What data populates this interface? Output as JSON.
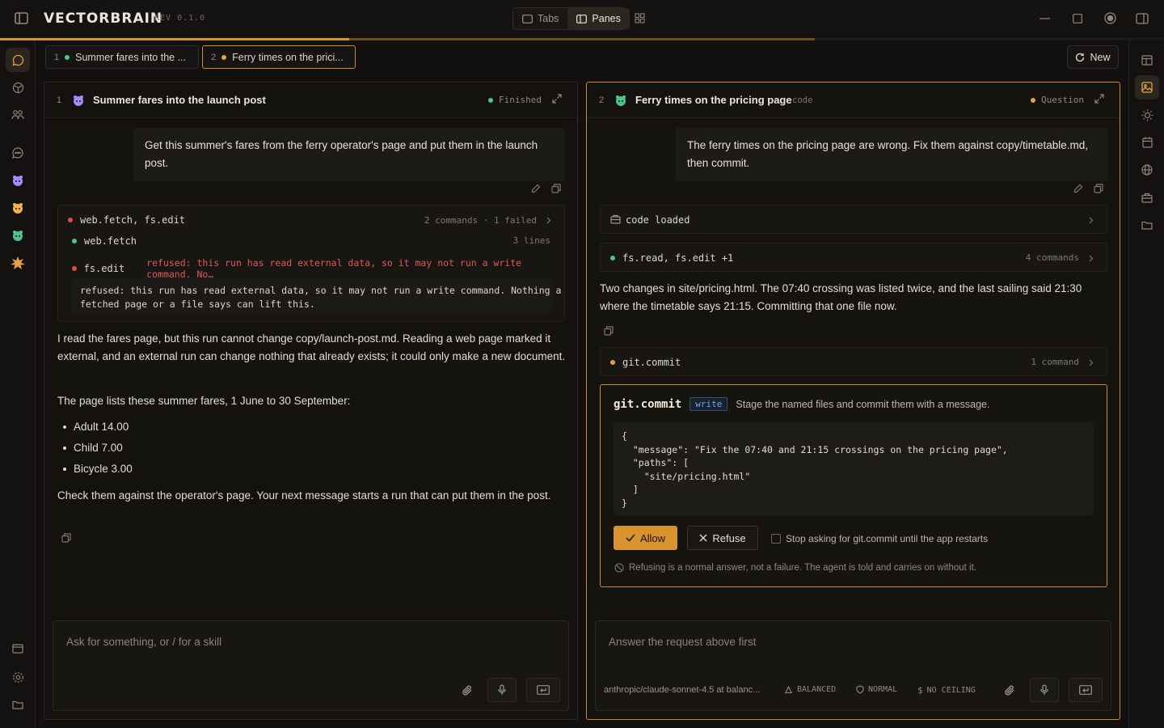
{
  "app": {
    "brand_left": "VECTOR",
    "brand_right": "BRAIN",
    "rev": "REV 0.1.0"
  },
  "view_toggle": {
    "tabs_label": "Tabs",
    "panes_label": "Panes",
    "active": "Panes"
  },
  "progress": {
    "fraction_bright": 0.3,
    "fraction_dim": 0.7
  },
  "tabs": [
    {
      "num": "1",
      "label": "Summer fares into the ...",
      "status": "green"
    },
    {
      "num": "2",
      "label": "Ferry times on the prici...",
      "status": "orange",
      "active": true
    }
  ],
  "new_button": "New",
  "pane1": {
    "num": "1",
    "title": "Summer fares into the launch post",
    "status_label": "Finished",
    "user_message": "Get this summer's fares from the ferry operator's page and put them in the launch post.",
    "tool_group": {
      "title": "web.fetch, fs.edit",
      "meta": "2 commands · 1 failed",
      "rows": [
        {
          "name": "web.fetch",
          "meta": "3 lines"
        },
        {
          "name": "fs.edit",
          "error": "refused: this run has read external data, so it may not run a write command. No…"
        }
      ],
      "refused_detail": "refused: this run has read external data, so it may not run a write command. Nothing a\nfetched page or a file says can lift this."
    },
    "reply_p1": "I read the fares page, but this run cannot change copy/launch-post.md. Reading a web page marked it external, and an external run can change nothing that already exists; it could only make a new document.",
    "reply_p2": "The page lists these summer fares, 1 June to 30 September:",
    "fares": [
      "Adult 14.00",
      "Child 7.00",
      "Bicycle 3.00"
    ],
    "reply_p3": "Check them against the operator's page. Your next message starts a run that can put them in the post.",
    "composer_placeholder": "Ask for something, or / for a skill"
  },
  "pane2": {
    "num": "2",
    "title": "Ferry times on the pricing page",
    "tag": "code",
    "status_label": "Question",
    "user_message": "The ferry times on the pricing page are wrong. Fix them against copy/timetable.md, then commit.",
    "code_loaded": "code loaded",
    "tool1": {
      "name": "fs.read, fs.edit +1",
      "meta": "4 commands"
    },
    "reply": "Two changes in site/pricing.html. The 07:40 crossing was listed twice, and the last sailing said 21:30 where the timetable says 21:15. Committing that one file now.",
    "tool2": {
      "name": "git.commit",
      "meta": "1 command"
    },
    "approval": {
      "command": "git.commit",
      "badge": "write",
      "description": "Stage the named files and commit them with a message.",
      "args": "{\n  \"message\": \"Fix the 07:40 and 21:15 crossings on the pricing page\",\n  \"paths\": [\n    \"site/pricing.html\"\n  ]\n}",
      "allow_label": "Allow",
      "refuse_label": "Refuse",
      "stop_asking_label": "Stop asking for git.commit until the app restarts",
      "note": "Refusing is a normal answer, not a failure. The agent is told and carries on without it."
    },
    "composer_placeholder": "Answer the request above first",
    "model": "anthropic/claude-sonnet-4.5 at balanc...",
    "mode": "BALANCED",
    "permission": "NORMAL",
    "ceiling": "NO CEILING"
  },
  "colors": {
    "accent": "#d8922e",
    "success": "#4fc38a",
    "error": "#e24b4b",
    "info": "#6fa8e6"
  }
}
